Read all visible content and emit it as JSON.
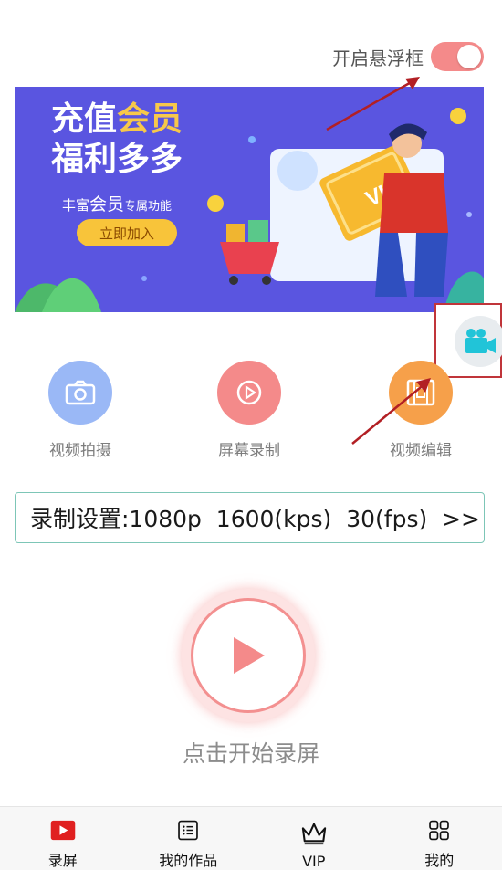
{
  "header": {
    "float_toggle_label": "开启悬浮框",
    "float_toggle_on": true
  },
  "banner": {
    "title_line1_a": "充值",
    "title_line1_b": "会员",
    "title_line2": "福利多多",
    "subtitle_a": "丰富",
    "subtitle_b": "会员",
    "subtitle_c": "专属功能",
    "cta_label": "立即加入",
    "vip_text": "VIP"
  },
  "features": [
    {
      "label": "视频拍摄",
      "icon": "camera-icon",
      "color": "#9ab8f6"
    },
    {
      "label": "屏幕录制",
      "icon": "screen-record-icon",
      "color": "#f48a8a"
    },
    {
      "label": "视频编辑",
      "icon": "film-icon",
      "color": "#f6a04a"
    }
  ],
  "settings_bar": {
    "text": "录制设置:1080p  1600(kps)  30(fps)  >>"
  },
  "record": {
    "label": "点击开始录屏"
  },
  "bottom_nav": [
    {
      "label": "录屏",
      "icon": "play-icon"
    },
    {
      "label": "我的作品",
      "icon": "list-icon"
    },
    {
      "label": "VIP",
      "icon": "crown-icon"
    },
    {
      "label": "我的",
      "icon": "grid-icon"
    }
  ],
  "colors": {
    "accent": "#f48a8a",
    "banner": "#5a55e0",
    "border": "#7dc6b7",
    "nav_active": "#e02020"
  }
}
